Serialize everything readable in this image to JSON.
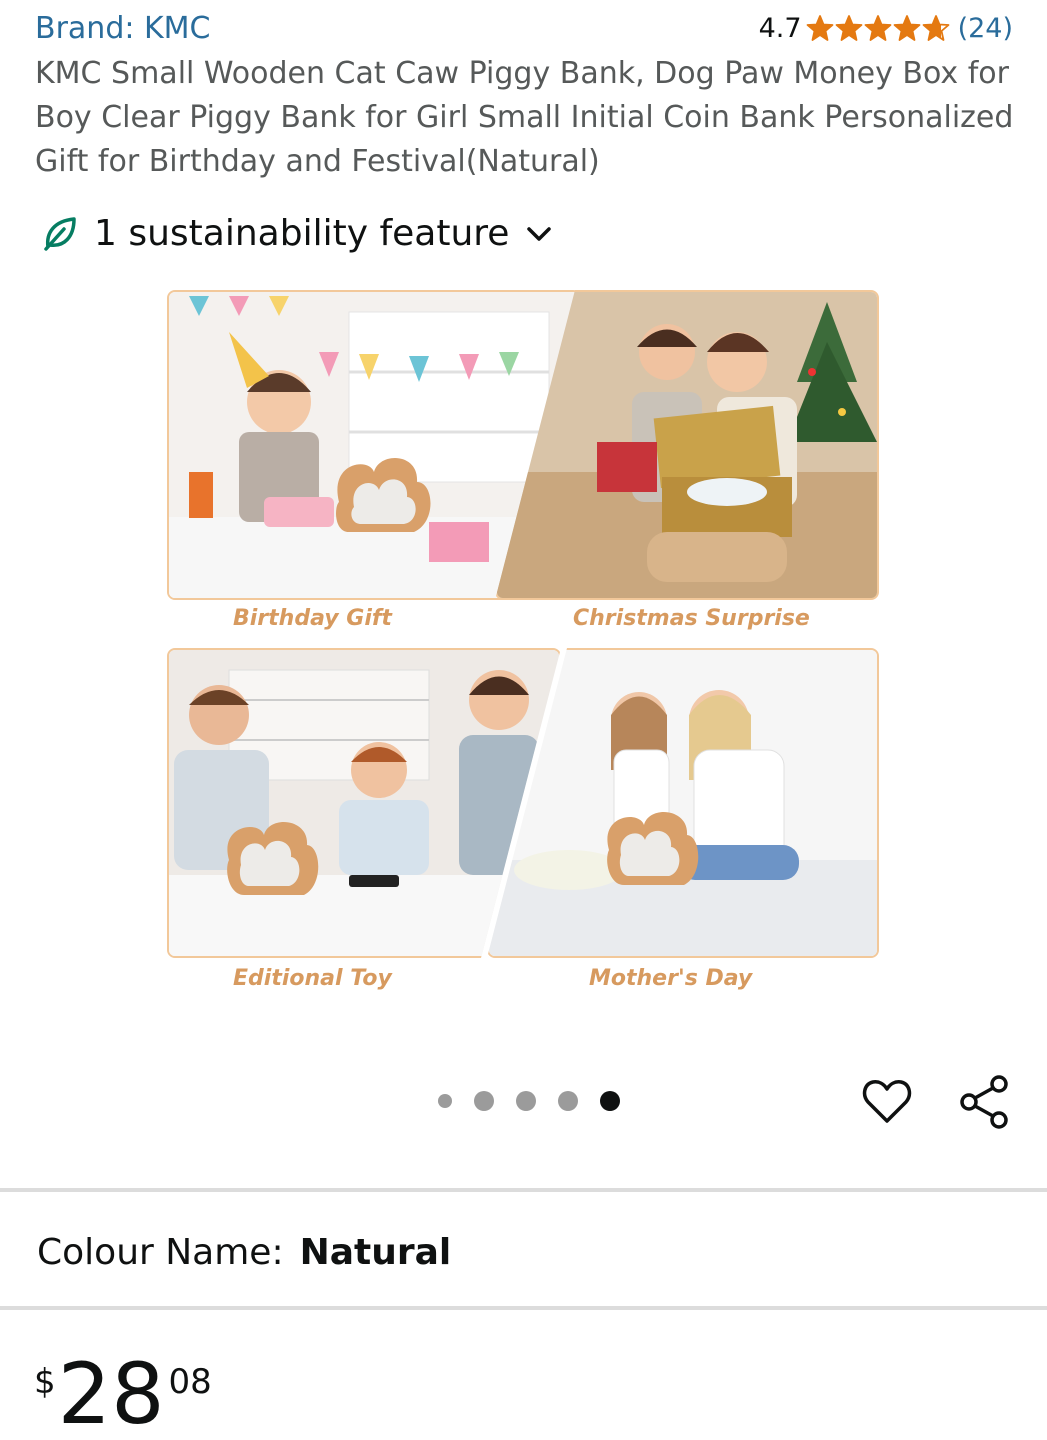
{
  "product": {
    "brand": "Brand: KMC",
    "rating_value": "4.7",
    "rating_stars": 4.7,
    "rating_count": "(24)",
    "title": "KMC Small Wooden Cat Caw Piggy Bank, Dog Paw Money Box for Boy Clear Piggy Bank for Girl Small Initial Coin Bank Personalized Gift for Birthday and Festival(Natural)"
  },
  "sustainability": {
    "label": "1 sustainability feature"
  },
  "gallery": {
    "captions": [
      "Birthday Gift",
      "Christmas Surprise",
      "Editional Toy",
      "Mother's Day"
    ],
    "image_count": 5,
    "active_index": 4
  },
  "colour": {
    "label": "Colour Name:",
    "value": "Natural"
  },
  "price": {
    "symbol": "$",
    "whole": "28",
    "fraction": "08"
  },
  "colors": {
    "link": "#2a6c9b",
    "star": "#e47911",
    "caption": "#d79a5f",
    "frame": "#f2c89a",
    "leaf": "#067d62"
  },
  "icons": [
    "star-icon",
    "leaf-icon",
    "chevron-down-icon",
    "heart-icon",
    "share-icon"
  ]
}
